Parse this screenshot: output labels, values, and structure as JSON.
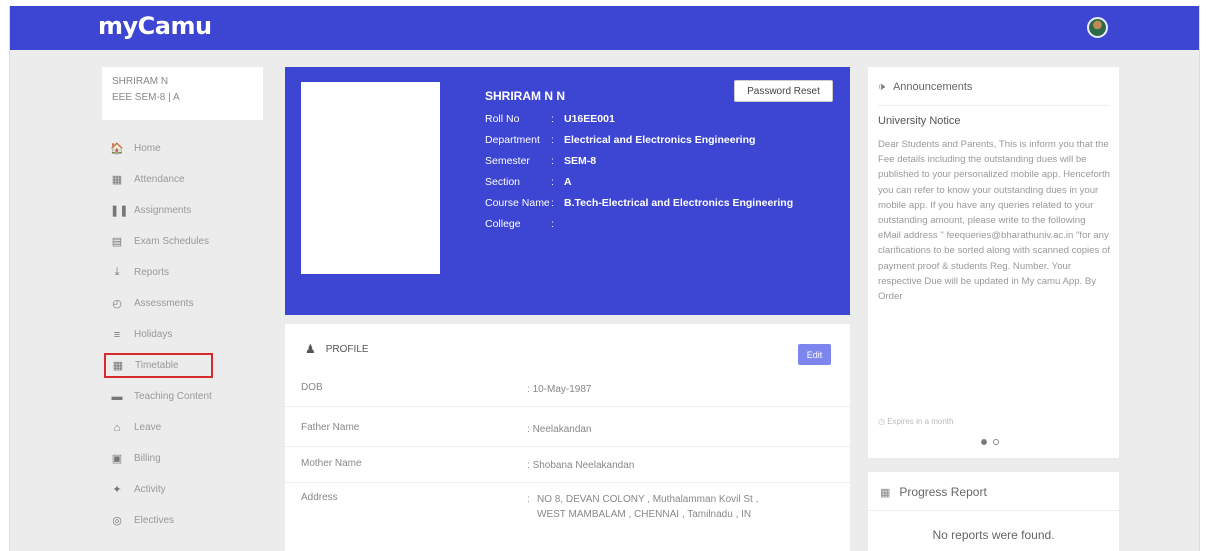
{
  "app": {
    "logo": "myCamu"
  },
  "student": {
    "name": "SHRIRAM N",
    "subtitle": "EEE SEM-8 | A"
  },
  "nav": [
    {
      "label": "Home",
      "icon": "home-icon",
      "glyph": "🏠"
    },
    {
      "label": "Attendance",
      "icon": "attendance-icon",
      "glyph": "▦"
    },
    {
      "label": "Assignments",
      "icon": "assignments-icon",
      "glyph": "❚❚"
    },
    {
      "label": "Exam Schedules",
      "icon": "exam-icon",
      "glyph": "▤"
    },
    {
      "label": "Reports",
      "icon": "reports-icon",
      "glyph": "⤓"
    },
    {
      "label": "Assessments",
      "icon": "assessments-icon",
      "glyph": "◴"
    },
    {
      "label": "Holidays",
      "icon": "holidays-icon",
      "glyph": "≡"
    },
    {
      "label": "Timetable",
      "icon": "timetable-icon",
      "glyph": "▦"
    },
    {
      "label": "Teaching Content",
      "icon": "teaching-content-icon",
      "glyph": "▬"
    },
    {
      "label": "Leave",
      "icon": "leave-icon",
      "glyph": "⌂"
    },
    {
      "label": "Billing",
      "icon": "billing-icon",
      "glyph": "▣"
    },
    {
      "label": "Activity",
      "icon": "activity-icon",
      "glyph": "✦"
    },
    {
      "label": "Electives",
      "icon": "electives-icon",
      "glyph": "◎"
    }
  ],
  "profile_header": {
    "name": "SHRIRAM N N",
    "password_reset": "Password Reset",
    "roll_label": "Roll No",
    "roll": "U16EE001",
    "dept_label": "Department",
    "dept": "Electrical and Electronics Engineering",
    "sem_label": "Semester",
    "sem": "SEM-8",
    "section_label": "Section",
    "section": "A",
    "course_label": "Course Name",
    "course": "B.Tech-Electrical and Electronics Engineering",
    "college_label": "College",
    "college": "",
    "separator": ":"
  },
  "profile": {
    "title": "PROFILE",
    "edit": "Edit",
    "dob_label": "DOB",
    "dob": "10-May-1987",
    "father_label": "Father Name",
    "father": "Neelakandan",
    "mother_label": "Mother Name",
    "mother": "Shobana Neelakandan",
    "address_label": "Address",
    "address": "NO 8, DEVAN COLONY , Muthalamman Kovil St , WEST MAMBALAM , CHENNAI , Tamilnadu , IN"
  },
  "announcements": {
    "title": "Announcements",
    "notice_title": "University Notice",
    "body": "Dear Students and Parents, This is inform you that the Fee details including the outstanding dues will be published to your personalized mobile app. Henceforth you can refer to know your outstanding dues in your mobile app. If you have any queries related to your outstanding amount, please write to the following eMail address \" feequeries@bharathuniv.ac.in \"for any clarifications to be sorted along with scanned copies of payment proof & students Reg. Number. Your respective Due will be updated in My camu App. By Order",
    "expires": "Expires in a month"
  },
  "progress": {
    "title": "Progress Report",
    "empty": "No reports were found."
  }
}
